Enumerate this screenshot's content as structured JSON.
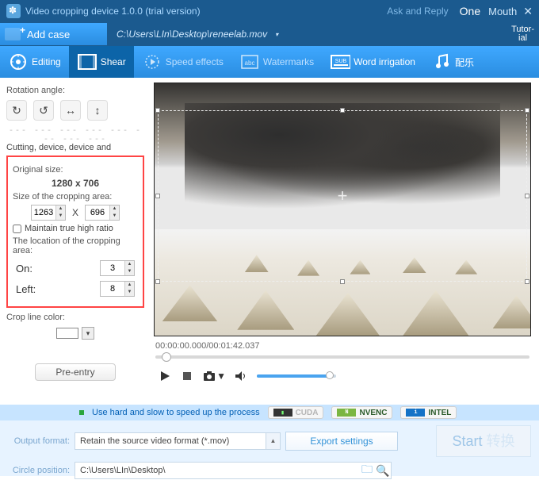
{
  "titlebar": {
    "title": "Video cropping device 1.0.0 (trial version)",
    "ask_and_reply": "Ask and Reply",
    "one": "One",
    "mouth": "Mouth",
    "close": "✕"
  },
  "casebar": {
    "add_label": "Add case",
    "filepath": "C:\\Users\\LIn\\Desktop\\reneelab.mov",
    "tutorial": "Tutor-\nial"
  },
  "toolbar": {
    "editing": "Editing",
    "shear": "Shear",
    "speed": "Speed effects",
    "watermarks": "Watermarks",
    "word_irrigation": "Word irrigation",
    "music": "配乐"
  },
  "panel": {
    "rotation_label": "Rotation angle:",
    "dashes": "--- --- --- --- --- --- --- ---",
    "cut_caption": "Cutting, device, device and",
    "original_size_label": "Original size:",
    "original_size_value": "1280 x 706",
    "crop_size_label": "Size of the cropping area:",
    "crop_w": "1263",
    "crop_h": "696",
    "x_sep": "X",
    "maintain_label": "Maintain true high ratio",
    "location_label": "The location of the cropping area:",
    "on_label": "On:",
    "on_value": "3",
    "left_label": "Left:",
    "left_value": "8",
    "cropcolor_label": "Crop line color:",
    "preentry": "Pre-entry"
  },
  "preview": {
    "timecode": "00:00:00.000/00:01:42.037"
  },
  "accel": {
    "msg": "Use hard and slow to speed up the process",
    "cuda": "CUDA",
    "nvenc": "NVENC",
    "intel": "INTEL"
  },
  "bottom": {
    "output_format_label": "Output format:",
    "output_format_value": "Retain the source video format (*.mov)",
    "export_settings": "Export settings",
    "start": "Start",
    "start_ghost": " 转换",
    "circle_pos_label": "Circle position:",
    "outpath": "C:\\Users\\LIn\\Desktop\\"
  }
}
